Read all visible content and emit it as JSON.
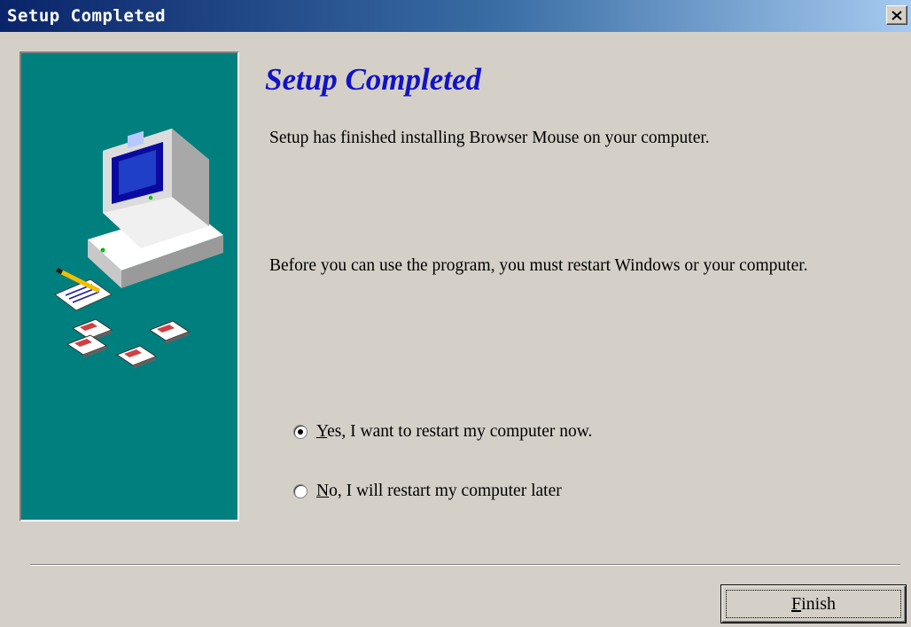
{
  "window": {
    "title": "Setup Completed",
    "close_label": "×"
  },
  "main": {
    "heading": "Setup Completed",
    "finished_text": "Setup has finished installing Browser Mouse on your computer.",
    "restart_text": "Before you can use the program, you must restart Windows or your computer.",
    "options": [
      {
        "mnemonic": "Y",
        "rest": "es, I want to restart my computer now.",
        "selected": true
      },
      {
        "mnemonic": "N",
        "rest": "o, I will restart my computer later",
        "selected": false
      }
    ]
  },
  "footer": {
    "finish_mnemonic": "F",
    "finish_rest": "inish"
  },
  "colors": {
    "panel": "#007f7f",
    "heading": "#1212c8",
    "titlebar_start": "#0a246a"
  },
  "icons": [
    "computer-icon",
    "notepad-icon",
    "floppy-disk-icon",
    "close-icon"
  ]
}
